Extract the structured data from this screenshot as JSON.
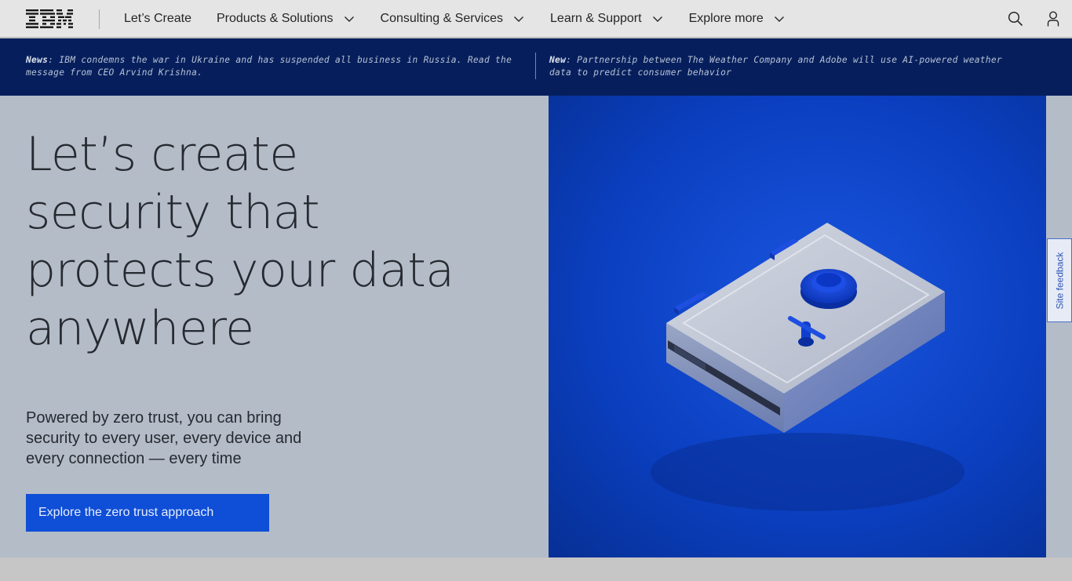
{
  "masthead": {
    "logo_text": "IBM",
    "nav": [
      {
        "label": "Let’s Create",
        "has_menu": false
      },
      {
        "label": "Products & Solutions",
        "has_menu": true
      },
      {
        "label": "Consulting & Services",
        "has_menu": true
      },
      {
        "label": "Learn & Support",
        "has_menu": true
      },
      {
        "label": "Explore more",
        "has_menu": true
      }
    ],
    "icons": [
      "search-icon",
      "user-icon"
    ]
  },
  "news": [
    {
      "prefix": "News",
      "text": ": IBM condemns the war in Ukraine and has suspended all business in Russia. Read the message from CEO Arvind Krishna."
    },
    {
      "prefix": "New",
      "text": ": Partnership between The Weather Company and Adobe will use AI-powered weather data to predict consumer behavior"
    }
  ],
  "hero": {
    "title": "Let’s create security that protects your data anywhere",
    "subtitle": "Powered by zero trust, you can bring security to every user, every device and every connection — every time",
    "cta_label": "Explore the zero trust approach"
  },
  "feedback": {
    "label": "Site feedback"
  },
  "colors": {
    "masthead_bg": "#e5e5e5",
    "newsbar_bg": "#061f5c",
    "hero_bg": "#b4bcc8",
    "cta_bg": "#0f4ed6",
    "image_blue": "#0a3fc2"
  }
}
